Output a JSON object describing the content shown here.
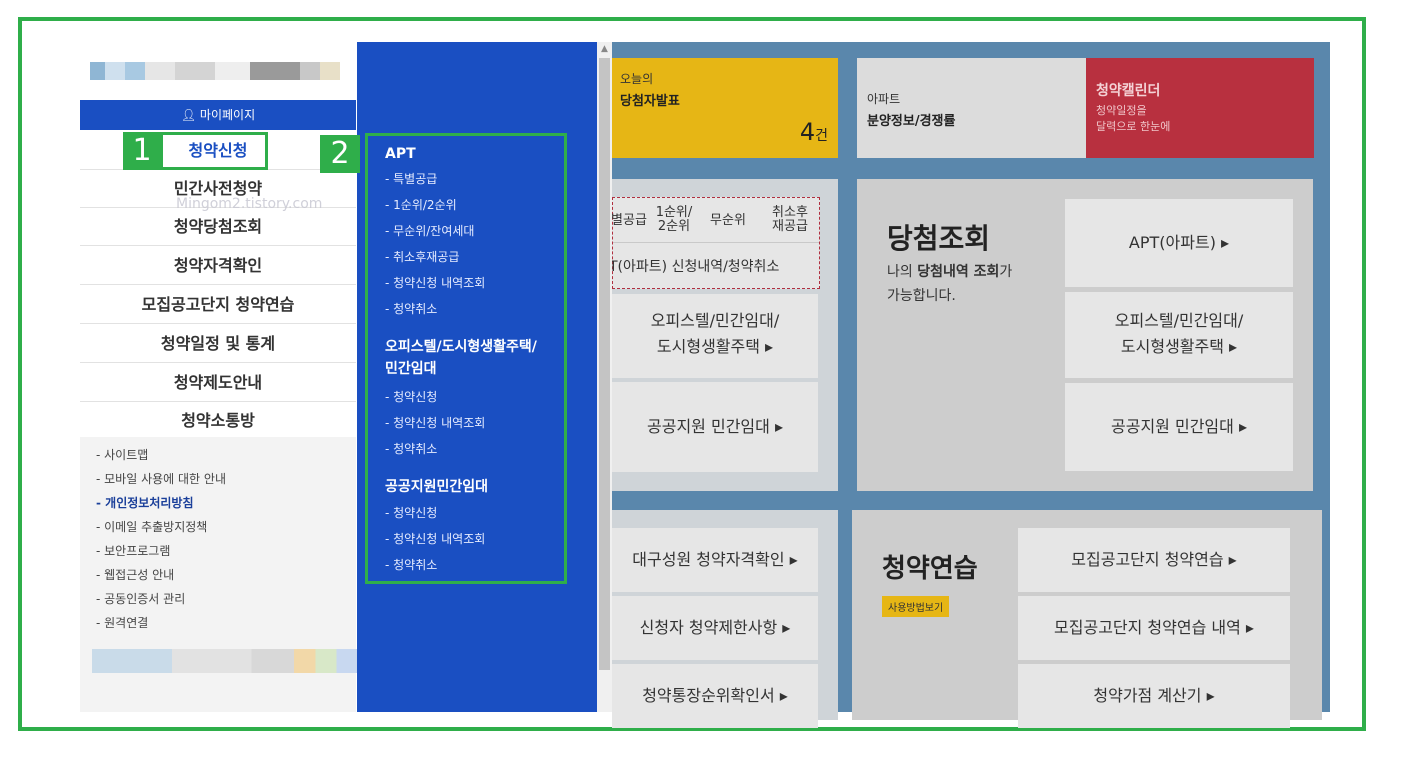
{
  "sidebar": {
    "mypage": "마이페이지",
    "menu": [
      "청약신청",
      "민간사전청약",
      "청약당첨조회",
      "청약자격확인",
      "모집공고단지 청약연습",
      "청약일정 및 통계",
      "청약제도안내",
      "청약소통방"
    ],
    "watermark": "Mingom2.tistory.com",
    "links": [
      "- 사이트맵",
      "- 모바일 사용에 대한 안내",
      "- 개인정보처리방침",
      "- 이메일 추출방지정책",
      "- 보안프로그램",
      "- 웹접근성 안내",
      "- 공동인증서 관리",
      "- 원격연결"
    ]
  },
  "callouts": {
    "one": "1",
    "two": "2"
  },
  "dropdown": {
    "apt_title": "APT",
    "apt_links": [
      "- 특별공급",
      "- 1순위/2순위",
      "- 무순위/잔여세대",
      "- 취소후재공급",
      "- 청약신청 내역조회",
      "- 청약취소"
    ],
    "officetel_title_1": "오피스텔/도시형생활주택/",
    "officetel_title_2": "민간임대",
    "officetel_links": [
      "- 청약신청",
      "- 청약신청 내역조회",
      "- 청약취소"
    ],
    "public_title": "공공지원민간임대",
    "public_links": [
      "- 청약신청",
      "- 청약신청 내역조회",
      "- 청약취소"
    ]
  },
  "top_cards": {
    "today_label": "오늘의",
    "today_title": "당첨자발표",
    "today_count": "4",
    "today_unit": "건",
    "apt_label": "아파트",
    "apt_title": "분양정보/경쟁률",
    "cal_title": "청약캘린더",
    "cal_sub_1": "청약일정을",
    "cal_sub_2": "달력으로 한눈에"
  },
  "apply_panel": {
    "cells": [
      "별공급",
      "1순위/\n2순위",
      "무순위",
      "취소후\n재공급"
    ],
    "apt_row": "T(아파트) 신청내역/청약취소",
    "officetel_1": "오피스텔/민간임대/",
    "officetel_2": "도시형생활주택 ▸",
    "public": "공공지원 민간임대 ▸"
  },
  "win_panel": {
    "title": "당첨조회",
    "desc_1_pre": "나의 ",
    "desc_1_bold": "당첨내역 조회",
    "desc_1_post": "가",
    "desc_2": "가능합니다.",
    "btn_apt": "APT(아파트) ▸",
    "btn_officetel_1": "오피스텔/민간임대/",
    "btn_officetel_2": "도시형생활주택  ▸",
    "btn_public": "공공지원 민간임대 ▸"
  },
  "qual_panel": {
    "btn1": "대구성원 청약자격확인 ▸",
    "btn2": "신청자 청약제한사항 ▸",
    "btn3": "청약통장순위확인서 ▸"
  },
  "practice_panel": {
    "title": "청약연습",
    "guide": "사용방법보기",
    "btn1": "모집공고단지 청약연습 ▸",
    "btn2": "모집공고단지 청약연습 내역 ▸",
    "btn3": "청약가점 계산기 ▸"
  },
  "colors": {
    "primary_blue": "#1a4fc2",
    "callout_green": "#2fae4a",
    "calendar_red": "#c0293a",
    "today_yellow": "#e8b400"
  }
}
